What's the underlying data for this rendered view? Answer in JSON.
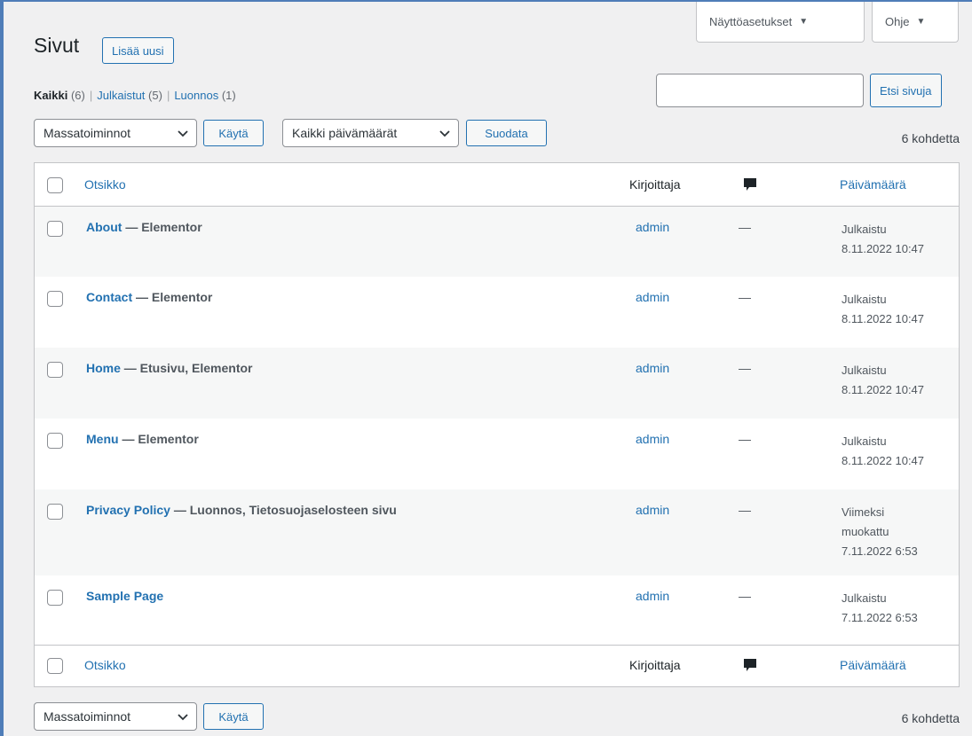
{
  "header": {
    "screen_options_label": "Näyttöasetukset",
    "help_label": "Ohje",
    "page_title": "Sivut",
    "add_new_label": "Lisää uusi"
  },
  "views": [
    {
      "label": "Kaikki",
      "count": "(6)"
    },
    {
      "label": "Julkaistut",
      "count": "(5)"
    },
    {
      "label": "Luonnos",
      "count": "(1)"
    }
  ],
  "search": {
    "value": "",
    "button_label": "Etsi sivuja"
  },
  "tablenav_top": {
    "bulk_select": "Massatoiminnot",
    "apply_label": "Käytä",
    "date_select": "Kaikki päivämäärät",
    "filter_label": "Suodata",
    "count": "6 kohdetta"
  },
  "table": {
    "columns": {
      "title": "Otsikko",
      "author": "Kirjoittaja",
      "comments_icon": "comment-bubble-icon",
      "date": "Päivämäärä"
    },
    "rows": [
      {
        "title": "About",
        "state": " — Elementor",
        "author": "admin",
        "comments": "—",
        "date_line1": "Julkaistu",
        "date_line2": "8.11.2022 10:47",
        "date_line3": ""
      },
      {
        "title": "Contact",
        "state": " — Elementor",
        "author": "admin",
        "comments": "—",
        "date_line1": "Julkaistu",
        "date_line2": "8.11.2022 10:47",
        "date_line3": ""
      },
      {
        "title": "Home",
        "state": " — Etusivu, Elementor",
        "author": "admin",
        "comments": "—",
        "date_line1": "Julkaistu",
        "date_line2": "8.11.2022 10:47",
        "date_line3": ""
      },
      {
        "title": "Menu",
        "state": " — Elementor",
        "author": "admin",
        "comments": "—",
        "date_line1": "Julkaistu",
        "date_line2": "8.11.2022 10:47",
        "date_line3": ""
      },
      {
        "title": "Privacy Policy",
        "state": " — Luonnos, Tietosuojaselosteen sivu",
        "author": "admin",
        "comments": "—",
        "date_line1": "Viimeksi",
        "date_line2": "muokattu",
        "date_line3": "7.11.2022 6:53"
      },
      {
        "title": "Sample Page",
        "state": "",
        "author": "admin",
        "comments": "—",
        "date_line1": "Julkaistu",
        "date_line2": "7.11.2022 6:53",
        "date_line3": ""
      }
    ]
  },
  "tablenav_bottom": {
    "bulk_select": "Massatoiminnot",
    "apply_label": "Käytä",
    "count": "6 kohdetta"
  },
  "colors": {
    "link": "#2271b1",
    "frame": "#4f7db8",
    "alt_row": "#f6f7f7"
  }
}
